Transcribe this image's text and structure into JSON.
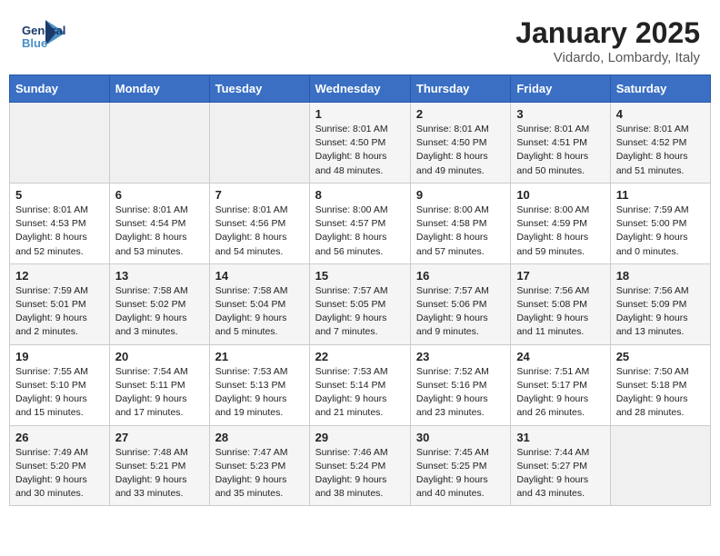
{
  "header": {
    "logo_line1": "General",
    "logo_line2": "Blue",
    "title": "January 2025",
    "subtitle": "Vidardo, Lombardy, Italy"
  },
  "weekdays": [
    "Sunday",
    "Monday",
    "Tuesday",
    "Wednesday",
    "Thursday",
    "Friday",
    "Saturday"
  ],
  "weeks": [
    [
      {
        "day": "",
        "info": ""
      },
      {
        "day": "",
        "info": ""
      },
      {
        "day": "",
        "info": ""
      },
      {
        "day": "1",
        "info": "Sunrise: 8:01 AM\nSunset: 4:50 PM\nDaylight: 8 hours\nand 48 minutes."
      },
      {
        "day": "2",
        "info": "Sunrise: 8:01 AM\nSunset: 4:50 PM\nDaylight: 8 hours\nand 49 minutes."
      },
      {
        "day": "3",
        "info": "Sunrise: 8:01 AM\nSunset: 4:51 PM\nDaylight: 8 hours\nand 50 minutes."
      },
      {
        "day": "4",
        "info": "Sunrise: 8:01 AM\nSunset: 4:52 PM\nDaylight: 8 hours\nand 51 minutes."
      }
    ],
    [
      {
        "day": "5",
        "info": "Sunrise: 8:01 AM\nSunset: 4:53 PM\nDaylight: 8 hours\nand 52 minutes."
      },
      {
        "day": "6",
        "info": "Sunrise: 8:01 AM\nSunset: 4:54 PM\nDaylight: 8 hours\nand 53 minutes."
      },
      {
        "day": "7",
        "info": "Sunrise: 8:01 AM\nSunset: 4:56 PM\nDaylight: 8 hours\nand 54 minutes."
      },
      {
        "day": "8",
        "info": "Sunrise: 8:00 AM\nSunset: 4:57 PM\nDaylight: 8 hours\nand 56 minutes."
      },
      {
        "day": "9",
        "info": "Sunrise: 8:00 AM\nSunset: 4:58 PM\nDaylight: 8 hours\nand 57 minutes."
      },
      {
        "day": "10",
        "info": "Sunrise: 8:00 AM\nSunset: 4:59 PM\nDaylight: 8 hours\nand 59 minutes."
      },
      {
        "day": "11",
        "info": "Sunrise: 7:59 AM\nSunset: 5:00 PM\nDaylight: 9 hours\nand 0 minutes."
      }
    ],
    [
      {
        "day": "12",
        "info": "Sunrise: 7:59 AM\nSunset: 5:01 PM\nDaylight: 9 hours\nand 2 minutes."
      },
      {
        "day": "13",
        "info": "Sunrise: 7:58 AM\nSunset: 5:02 PM\nDaylight: 9 hours\nand 3 minutes."
      },
      {
        "day": "14",
        "info": "Sunrise: 7:58 AM\nSunset: 5:04 PM\nDaylight: 9 hours\nand 5 minutes."
      },
      {
        "day": "15",
        "info": "Sunrise: 7:57 AM\nSunset: 5:05 PM\nDaylight: 9 hours\nand 7 minutes."
      },
      {
        "day": "16",
        "info": "Sunrise: 7:57 AM\nSunset: 5:06 PM\nDaylight: 9 hours\nand 9 minutes."
      },
      {
        "day": "17",
        "info": "Sunrise: 7:56 AM\nSunset: 5:08 PM\nDaylight: 9 hours\nand 11 minutes."
      },
      {
        "day": "18",
        "info": "Sunrise: 7:56 AM\nSunset: 5:09 PM\nDaylight: 9 hours\nand 13 minutes."
      }
    ],
    [
      {
        "day": "19",
        "info": "Sunrise: 7:55 AM\nSunset: 5:10 PM\nDaylight: 9 hours\nand 15 minutes."
      },
      {
        "day": "20",
        "info": "Sunrise: 7:54 AM\nSunset: 5:11 PM\nDaylight: 9 hours\nand 17 minutes."
      },
      {
        "day": "21",
        "info": "Sunrise: 7:53 AM\nSunset: 5:13 PM\nDaylight: 9 hours\nand 19 minutes."
      },
      {
        "day": "22",
        "info": "Sunrise: 7:53 AM\nSunset: 5:14 PM\nDaylight: 9 hours\nand 21 minutes."
      },
      {
        "day": "23",
        "info": "Sunrise: 7:52 AM\nSunset: 5:16 PM\nDaylight: 9 hours\nand 23 minutes."
      },
      {
        "day": "24",
        "info": "Sunrise: 7:51 AM\nSunset: 5:17 PM\nDaylight: 9 hours\nand 26 minutes."
      },
      {
        "day": "25",
        "info": "Sunrise: 7:50 AM\nSunset: 5:18 PM\nDaylight: 9 hours\nand 28 minutes."
      }
    ],
    [
      {
        "day": "26",
        "info": "Sunrise: 7:49 AM\nSunset: 5:20 PM\nDaylight: 9 hours\nand 30 minutes."
      },
      {
        "day": "27",
        "info": "Sunrise: 7:48 AM\nSunset: 5:21 PM\nDaylight: 9 hours\nand 33 minutes."
      },
      {
        "day": "28",
        "info": "Sunrise: 7:47 AM\nSunset: 5:23 PM\nDaylight: 9 hours\nand 35 minutes."
      },
      {
        "day": "29",
        "info": "Sunrise: 7:46 AM\nSunset: 5:24 PM\nDaylight: 9 hours\nand 38 minutes."
      },
      {
        "day": "30",
        "info": "Sunrise: 7:45 AM\nSunset: 5:25 PM\nDaylight: 9 hours\nand 40 minutes."
      },
      {
        "day": "31",
        "info": "Sunrise: 7:44 AM\nSunset: 5:27 PM\nDaylight: 9 hours\nand 43 minutes."
      },
      {
        "day": "",
        "info": ""
      }
    ]
  ]
}
